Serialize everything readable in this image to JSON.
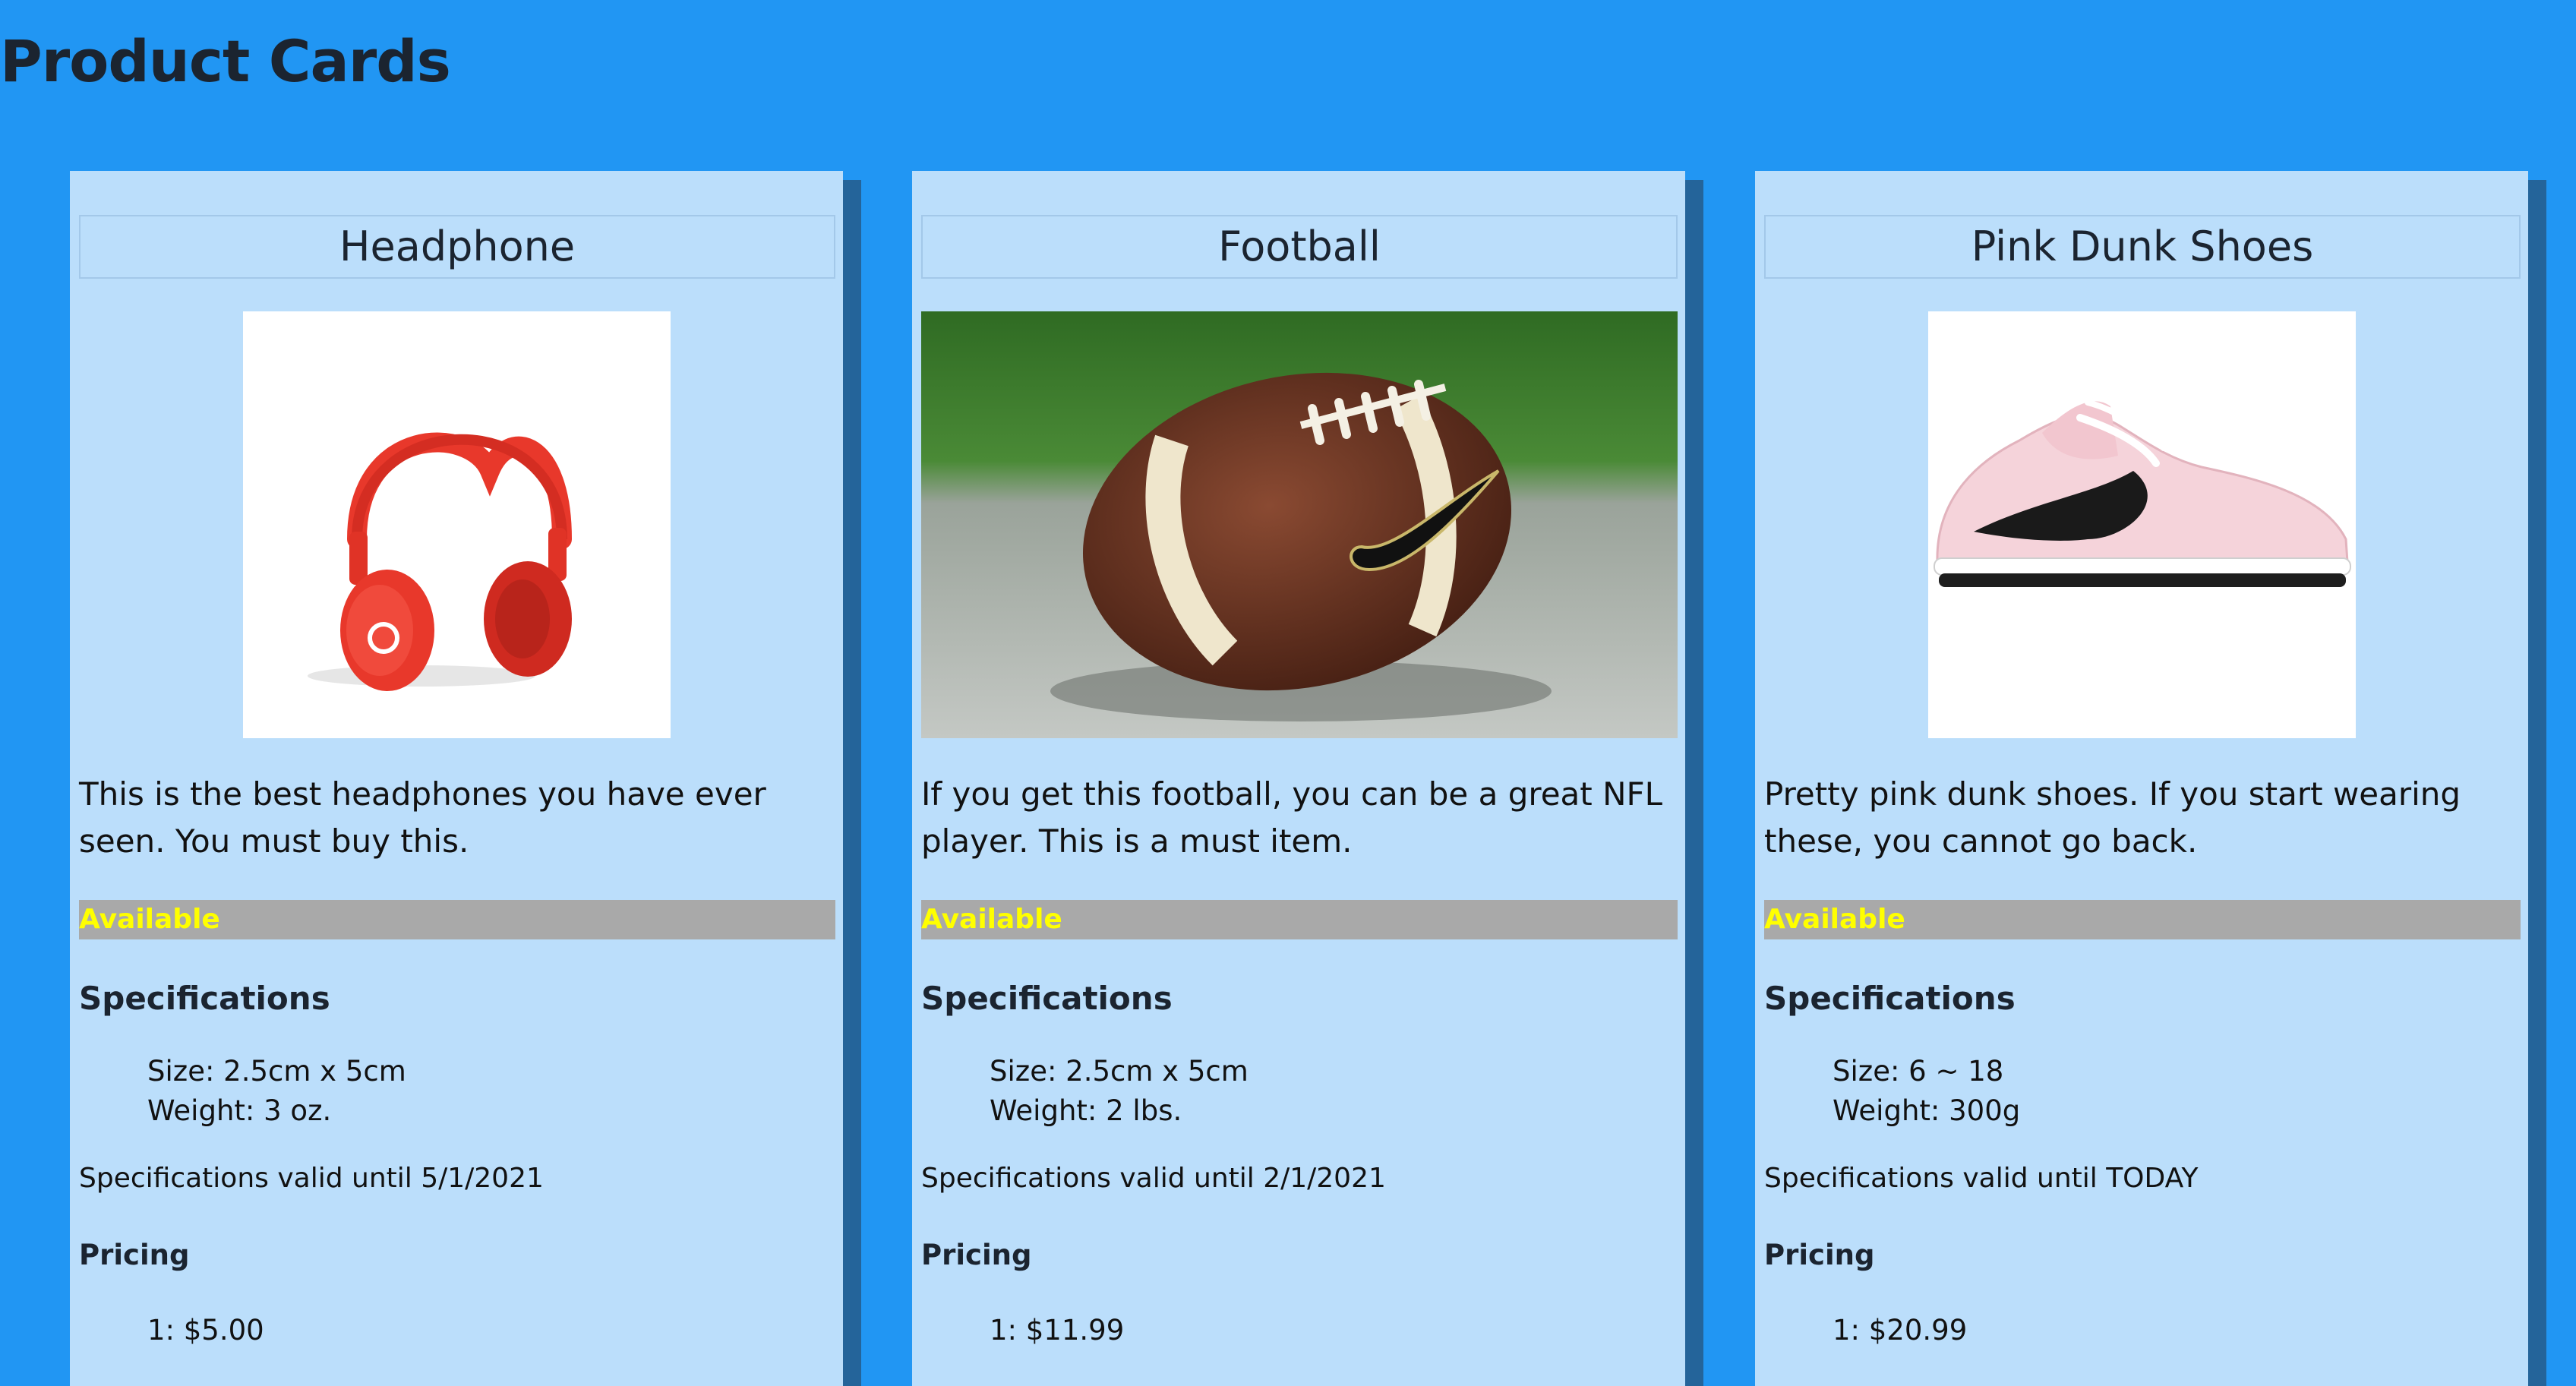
{
  "page": {
    "title": "Product Cards"
  },
  "cards": [
    {
      "title": "Headphone",
      "image_icon": "red-headphones-image",
      "description": "This is the best headphones you have ever seen. You must buy this.",
      "availability": "Available",
      "spec_heading": "Specifications",
      "size_line": "Size: 2.5cm x 5cm",
      "weight_line": "Weight: 3 oz.",
      "valid_line": "Specifications valid until 5/1/2021",
      "pricing_heading": "Pricing",
      "price_line": "1: $5.00"
    },
    {
      "title": "Football",
      "image_icon": "football-on-grass-image",
      "description": "If you get this football, you can be a great NFL player. This is a must item.",
      "availability": "Available",
      "spec_heading": "Specifications",
      "size_line": "Size: 2.5cm x 5cm",
      "weight_line": "Weight: 2 lbs.",
      "valid_line": "Specifications valid until 2/1/2021",
      "pricing_heading": "Pricing",
      "price_line": "1: $11.99"
    },
    {
      "title": "Pink Dunk Shoes",
      "image_icon": "pink-sneaker-image",
      "description": "Pretty pink dunk shoes. If you start wearing these, you cannot go back.",
      "availability": "Available",
      "spec_heading": "Specifications",
      "size_line": "Size: 6 ~ 18",
      "weight_line": "Weight: 300g",
      "valid_line": "Specifications valid until TODAY",
      "pricing_heading": "Pricing",
      "price_line": "1: $20.99"
    }
  ],
  "colors": {
    "page_background": "#2196f3",
    "card_background": "#bbdefb",
    "availability_bar": "#a9a9a9",
    "availability_text": "#ffff00"
  }
}
